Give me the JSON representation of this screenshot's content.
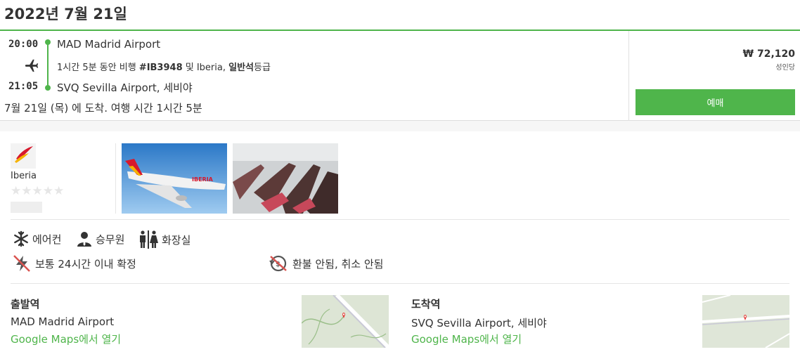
{
  "header": {
    "date_title": "2022년 7월 21일"
  },
  "flight": {
    "departure_time": "20:00",
    "arrival_time": "21:05",
    "departure_airport": "MAD Madrid Airport",
    "arrival_airport": "SVQ Sevilla Airport, 세비야",
    "duration_prefix": "1시간 5분 동안 비행 ",
    "flight_number": "#IB3948",
    "and_text": " 및 Iberia, ",
    "cabin_class": "일반석",
    "class_suffix": "등급",
    "arrival_note": "7월 21일 (목) 에 도착. 여행 시간 1시간 5분",
    "plane_icon": "airplane-icon"
  },
  "booking": {
    "price": "₩ 72,120",
    "per_person": "성인당",
    "book_label": "예매",
    "accent_color": "#4fb54b"
  },
  "airline": {
    "name": "Iberia",
    "stars": "★★★★★",
    "logo_icon": "iberia-logo"
  },
  "amenities": [
    {
      "label": "에어컨",
      "icon": "snowflake-icon"
    },
    {
      "label": "승무원",
      "icon": "crew-icon"
    },
    {
      "label": "화장실",
      "icon": "restroom-icon"
    }
  ],
  "policies": [
    {
      "label": "보통 24시간 이내 확정",
      "icon": "no-instant-icon"
    },
    {
      "label": "환불 안됨, 취소 안됨",
      "icon": "no-refund-icon"
    }
  ],
  "stations": {
    "departure": {
      "title": "출발역",
      "name": "MAD Madrid Airport",
      "link": "Google Maps에서 열기"
    },
    "arrival": {
      "title": "도착역",
      "name": "SVQ Sevilla Airport, 세비야",
      "link": "Google Maps에서 열기"
    }
  }
}
